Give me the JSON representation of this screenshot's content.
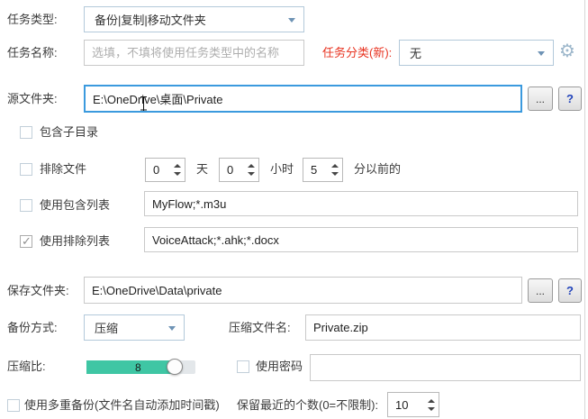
{
  "form": {
    "task_type": {
      "label": "任务类型:",
      "value": "备份|复制|移动文件夹"
    },
    "task_name": {
      "label": "任务名称:",
      "placeholder": "选填，不填将使用任务类型中的名称"
    },
    "task_category": {
      "label": "任务分类(新):",
      "value": "无"
    },
    "source_folder": {
      "label": "源文件夹:",
      "value": "E:\\OneDrive\\桌面\\Private",
      "browse_label": "...",
      "help_label": "?"
    },
    "include_subdirs": {
      "label": "包含子目录",
      "checked": false
    },
    "exclude_files": {
      "label": "排除文件",
      "checked": false,
      "days": "0",
      "days_unit": "天",
      "hours": "0",
      "hours_unit": "小时",
      "minutes": "5",
      "minutes_suffix": "分以前的"
    },
    "include_list": {
      "label": "使用包含列表",
      "checked": false,
      "value": "MyFlow;*.m3u"
    },
    "exclude_list": {
      "label": "使用排除列表",
      "checked": true,
      "value": "VoiceAttack;*.ahk;*.docx"
    },
    "save_folder": {
      "label": "保存文件夹:",
      "value": "E:\\OneDrive\\Data\\private",
      "browse_label": "...",
      "help_label": "?"
    },
    "backup_method": {
      "label": "备份方式:",
      "value": "压缩"
    },
    "zip_name": {
      "label": "压缩文件名:",
      "value": "Private.zip"
    },
    "compression": {
      "label": "压缩比:",
      "value": "8"
    },
    "use_password": {
      "label": "使用密码",
      "checked": false,
      "value": ""
    },
    "multi_backup": {
      "label": "使用多重备份(文件名自动添加时间戳)",
      "checked": false
    },
    "keep_count": {
      "label": "保留最近的个数(0=不限制):",
      "value": "10"
    }
  },
  "icons": {
    "gear": "⚙"
  },
  "colors": {
    "focus_border": "#3b9ade",
    "slider_fill": "#3fc6a4",
    "category_label": "#e8321f",
    "combo_border": "#b3c9da"
  }
}
